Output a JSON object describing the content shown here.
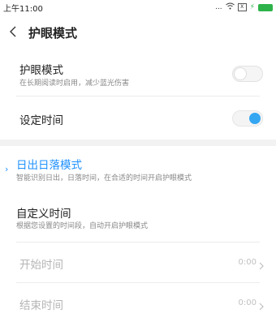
{
  "status_bar": {
    "time": "上午11:00",
    "dots": "...",
    "sim": "X"
  },
  "header": {
    "title": "护眼模式"
  },
  "settings": {
    "eye_mode": {
      "title": "护眼模式",
      "subtitle": "在长期阅读时启用，减少蓝光伤害",
      "enabled": false
    },
    "schedule": {
      "title": "设定时间",
      "enabled": true
    }
  },
  "modes": {
    "sunrise_sunset": {
      "title": "日出日落模式",
      "subtitle": "智能识别日出，日落时间，在合适的时间开启护眼模式",
      "selected": true
    },
    "custom": {
      "title": "自定义时间",
      "subtitle": "根据您设置的时间段，自动开启护眼模式"
    },
    "start_time": {
      "label": "开始时间",
      "value": "0:00"
    },
    "end_time": {
      "label": "结束时间",
      "value": "0:00"
    }
  },
  "colors": {
    "accent": "#1e90ff",
    "toggle_on": "#35a6f2",
    "battery": "#2db34a"
  }
}
